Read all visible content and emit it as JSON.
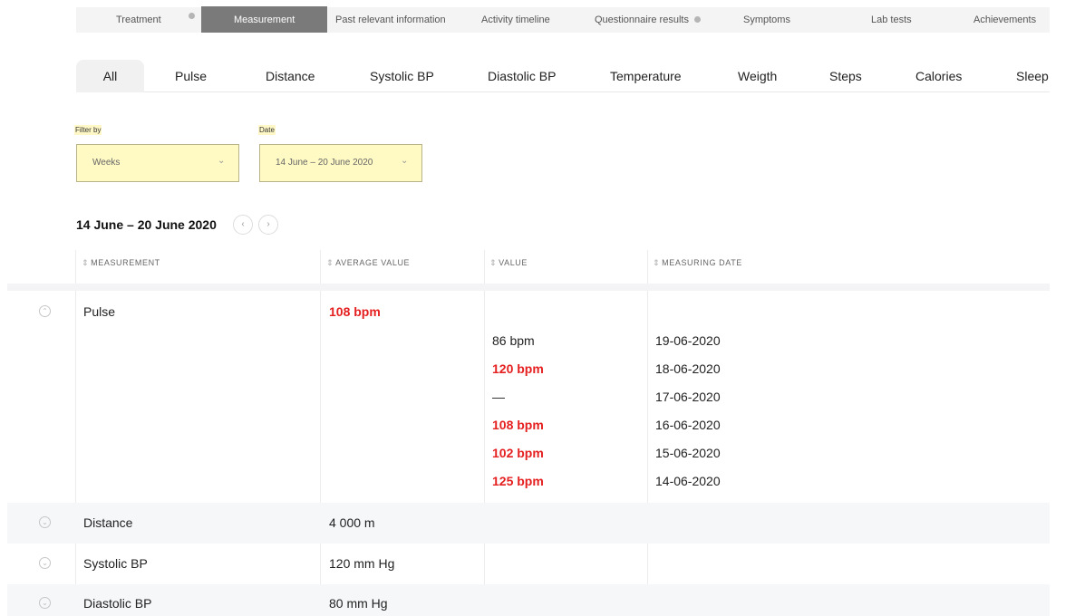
{
  "top_nav": {
    "tabs": [
      {
        "label": "Treatment",
        "active": false,
        "dot": true
      },
      {
        "label": "Measurement",
        "active": true,
        "dot": false
      },
      {
        "label": "Past relevant information",
        "active": false,
        "dot": false
      },
      {
        "label": "Activity timeline",
        "active": false,
        "dot": false
      },
      {
        "label": "Questionnaire results",
        "active": false,
        "dot": true
      },
      {
        "label": "Symptoms",
        "active": false,
        "dot": false
      },
      {
        "label": "Lab tests",
        "active": false,
        "dot": false
      },
      {
        "label": "Achievements",
        "active": false,
        "dot": false
      }
    ]
  },
  "measurement_tabs": {
    "active": "All",
    "items": [
      "All",
      "Pulse",
      "Distance",
      "Systolic BP",
      "Diastolic BP",
      "Temperature",
      "Weigth",
      "Steps",
      "Calories",
      "Sleep"
    ]
  },
  "filters": {
    "filter_by": {
      "label": "Filter by",
      "value": "Weeks"
    },
    "date": {
      "label": "Date",
      "value": "14 June – 20 June 2020"
    }
  },
  "period": {
    "title": "14 June – 20 June 2020",
    "prev_icon": "chevron-left-icon",
    "next_icon": "chevron-right-icon"
  },
  "table": {
    "headers": [
      "MEASUREMENT",
      "AVERAGE VALUE",
      "VALUE",
      "MEASURING DATE"
    ],
    "rows": [
      {
        "name": "Pulse",
        "average": "108 bpm",
        "average_alert": true,
        "expanded": true,
        "details": [
          {
            "value": "86 bpm",
            "alert": false,
            "date": "19-06-2020"
          },
          {
            "value": "120 bpm",
            "alert": true,
            "date": "18-06-2020"
          },
          {
            "value": "—",
            "alert": false,
            "date": "17-06-2020"
          },
          {
            "value": "108 bpm",
            "alert": true,
            "date": "16-06-2020"
          },
          {
            "value": "102 bpm",
            "alert": true,
            "date": "15-06-2020"
          },
          {
            "value": "125 bpm",
            "alert": true,
            "date": "14-06-2020"
          }
        ]
      },
      {
        "name": "Distance",
        "average": "4 000 m",
        "average_alert": false,
        "expanded": false
      },
      {
        "name": "Systolic BP",
        "average": "120 mm Hg",
        "average_alert": false,
        "expanded": false
      },
      {
        "name": "Diastolic BP",
        "average": "80 mm Hg",
        "average_alert": false,
        "expanded": false
      }
    ]
  },
  "colors": {
    "alert": "#e51f1f",
    "active_top_tab": "#7a7a7a",
    "select_bg": "#fff9c4",
    "row_band": "#f6f7f9"
  }
}
